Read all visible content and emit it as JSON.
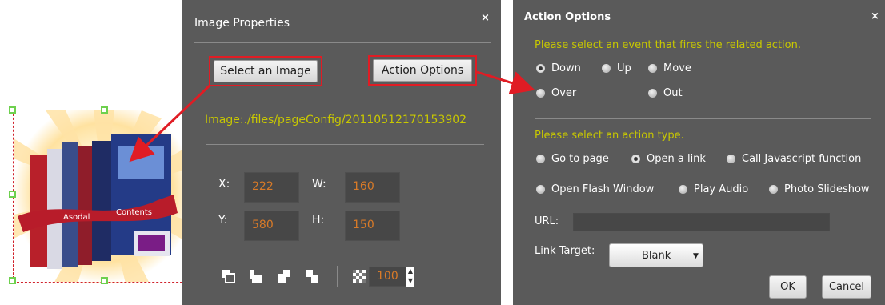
{
  "image_properties": {
    "title": "Image Properties",
    "close_glyph": "×",
    "select_image_label": "Select an Image",
    "action_options_label": "Action Options",
    "image_path": "Image:./files/pageConfig/20110512170153902",
    "fields": {
      "x_label": "X:",
      "x_value": "222",
      "w_label": "W:",
      "w_value": "160",
      "y_label": "Y:",
      "y_value": "580",
      "h_label": "H:",
      "h_value": "150"
    },
    "toolbar": {
      "icons": [
        "bring-to-front-icon",
        "bring-forward-icon",
        "send-backward-icon",
        "send-to-back-icon",
        "opacity-icon"
      ],
      "opacity_value": "100"
    }
  },
  "book_image": {
    "ribbon_left": "Asodal",
    "ribbon_right": "Contents"
  },
  "action_options": {
    "title": "Action Options",
    "close_glyph": "×",
    "event_prompt": "Please select an event that fires the related action.",
    "events": [
      {
        "label": "Down",
        "selected": true
      },
      {
        "label": "Up",
        "selected": false
      },
      {
        "label": "Move",
        "selected": false
      },
      {
        "label": "Over",
        "selected": false
      },
      {
        "label": "Out",
        "selected": false
      }
    ],
    "action_prompt": "Please select an action type.",
    "actions": [
      {
        "label": "Go to page",
        "selected": false
      },
      {
        "label": "Open a link",
        "selected": true
      },
      {
        "label": "Call Javascript function",
        "selected": false
      },
      {
        "label": "Open Flash Window",
        "selected": false
      },
      {
        "label": "Play Audio",
        "selected": false
      },
      {
        "label": "Photo Slideshow",
        "selected": false
      }
    ],
    "url_label": "URL:",
    "url_value": "",
    "link_target_label": "Link Target:",
    "link_target_value": "Blank",
    "ok_label": "OK",
    "cancel_label": "Cancel"
  },
  "colors": {
    "panel_bg": "#5a5a5a",
    "accent_yellow": "#c8c800",
    "field_value_orange": "#d87a28",
    "callout_red": "#e01c24",
    "handle_green": "#6ed04e"
  }
}
